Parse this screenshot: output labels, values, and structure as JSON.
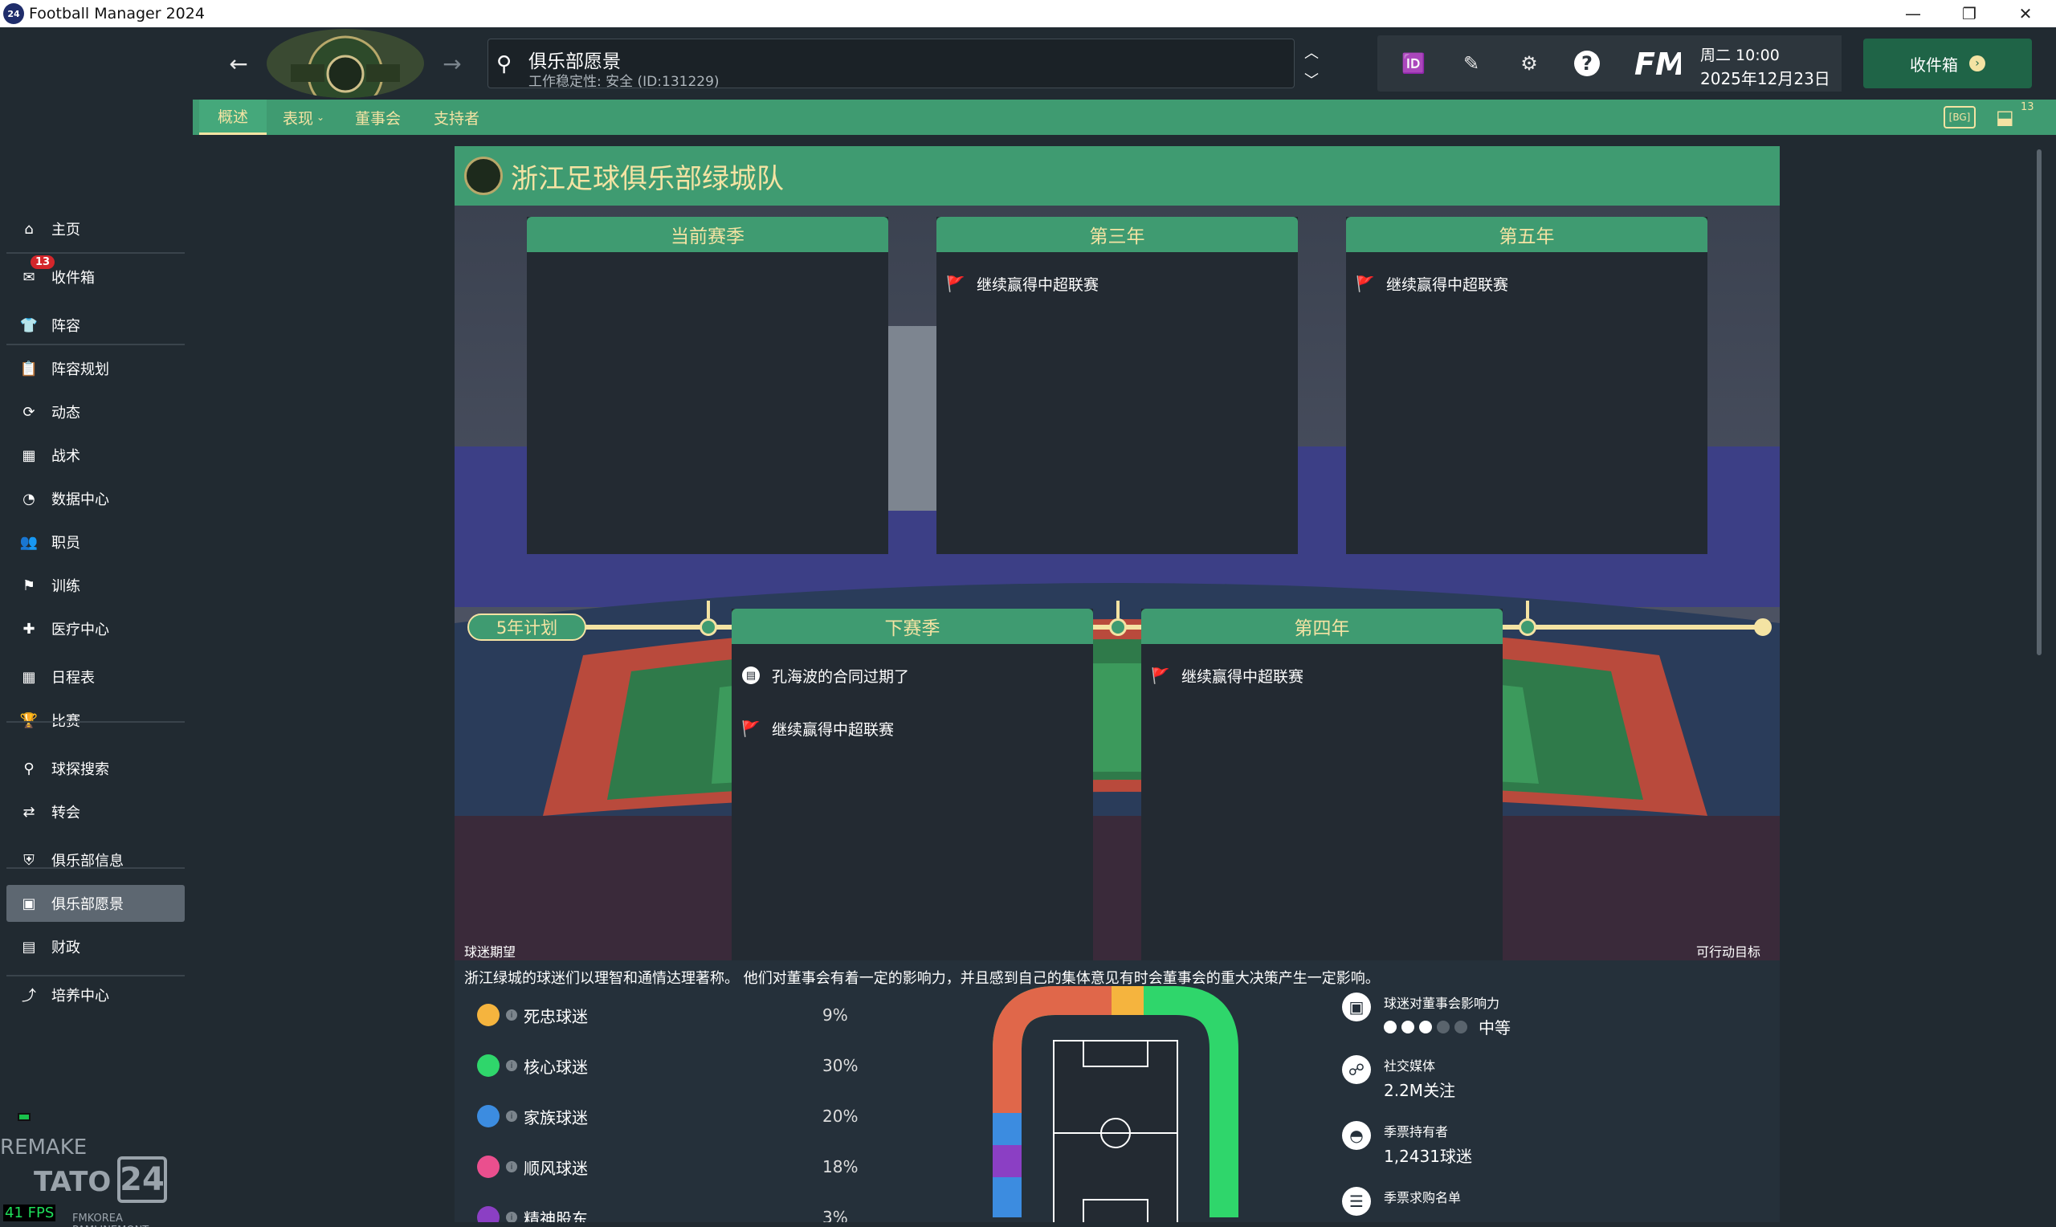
{
  "window": {
    "title": "Football Manager 2024",
    "logo": "24"
  },
  "sidebar": {
    "items": [
      {
        "label": "主页",
        "icon": "home-icon"
      },
      {
        "label": "收件箱",
        "icon": "inbox-icon",
        "badge": "13"
      },
      {
        "label": "阵容",
        "icon": "shirt-icon"
      },
      {
        "label": "阵容规划",
        "icon": "clipboard-icon"
      },
      {
        "label": "动态",
        "icon": "dynamics-icon"
      },
      {
        "label": "战术",
        "icon": "tactics-icon"
      },
      {
        "label": "数据中心",
        "icon": "data-hub-icon"
      },
      {
        "label": "职员",
        "icon": "staff-icon"
      },
      {
        "label": "训练",
        "icon": "training-icon"
      },
      {
        "label": "医疗中心",
        "icon": "medical-icon"
      },
      {
        "label": "日程表",
        "icon": "calendar-icon"
      },
      {
        "label": "比赛",
        "icon": "trophy-icon"
      },
      {
        "label": "球探搜索",
        "icon": "scout-icon"
      },
      {
        "label": "转会",
        "icon": "transfer-icon"
      },
      {
        "label": "俱乐部信息",
        "icon": "shield-icon"
      },
      {
        "label": "俱乐部愿景",
        "icon": "vision-icon"
      },
      {
        "label": "财政",
        "icon": "finance-icon"
      },
      {
        "label": "培养中心",
        "icon": "development-icon"
      }
    ],
    "watermark": {
      "remake": "REMAKE",
      "tato": "TATO",
      "num": "24",
      "credit": "FMKOREA PAMLINEMONT",
      "fps": "41 FPS"
    }
  },
  "header": {
    "search_title": "俱乐部愿景",
    "search_sub": "工作稳定性: 安全 (ID:131229)",
    "date_day": "周二 10:00",
    "date": "2025年12月23日",
    "inbox_btn": "收件箱",
    "fm_logo": "FM"
  },
  "tabs": [
    "概述",
    "表现",
    "董事会",
    "支持者"
  ],
  "tab_right": {
    "count": "13"
  },
  "panel": {
    "title": "浙江足球俱乐部绿城队",
    "years_top": [
      {
        "title": "当前赛季",
        "goals": []
      },
      {
        "title": "第三年",
        "goals": [
          "继续赢得中超联赛"
        ]
      },
      {
        "title": "第五年",
        "goals": [
          "继续赢得中超联赛"
        ]
      }
    ],
    "years_bottom": [
      {
        "title": "下赛季",
        "goals": [
          "孔海波的合同过期了",
          "继续赢得中超联赛"
        ]
      },
      {
        "title": "第四年",
        "goals": [
          "继续赢得中超联赛"
        ]
      }
    ],
    "plan_label": "5年计划",
    "fan_exp": "球迷期望",
    "actionable": "可行动目标",
    "fan_desc": "浙江绿城的球迷们以理智和通情达理著称。 他们对董事会有着一定的影响力，并且感到自己的集体意见有时会董事会的重大决策产生一定影响。",
    "fans": [
      {
        "label": "死忠球迷",
        "pct": "9%",
        "color": "#f5b43e"
      },
      {
        "label": "核心球迷",
        "pct": "30%",
        "color": "#2fd66b"
      },
      {
        "label": "家族球迷",
        "pct": "20%",
        "color": "#3c8ce0"
      },
      {
        "label": "顺风球迷",
        "pct": "18%",
        "color": "#ea4f8e"
      },
      {
        "label": "精神股东",
        "pct": "3%",
        "color": "#8b3fc4"
      }
    ],
    "stats": [
      {
        "label": "球迷对董事会影响力",
        "value": "中等",
        "dots_filled": 3,
        "dots_total": 5
      },
      {
        "label": "社交媒体",
        "value": "2.2M关注"
      },
      {
        "label": "季票持有者",
        "value": "1,2431球迷"
      },
      {
        "label": "季票求购名单",
        "value": ""
      }
    ]
  }
}
